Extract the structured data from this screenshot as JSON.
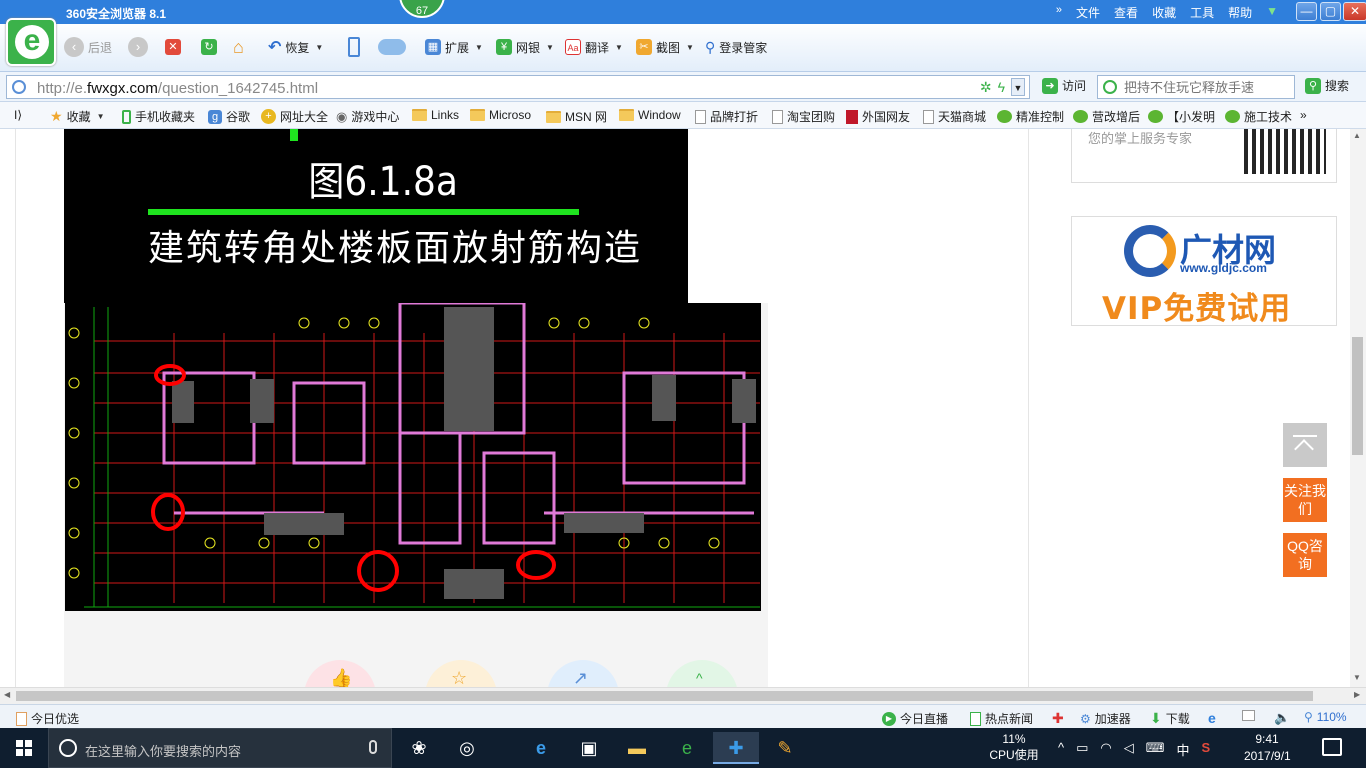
{
  "browser": {
    "title": "360安全浏览器 8.1",
    "badge_count": "67",
    "menu": [
      "文件",
      "查看",
      "收藏",
      "工具",
      "帮助"
    ],
    "chevron": "»",
    "window_buttons": [
      "—",
      "▢",
      "✕"
    ]
  },
  "toolbar": {
    "back": "后退",
    "restore": "恢复",
    "extend": "扩展",
    "netbank": "网银",
    "translate": "翻译",
    "screenshot": "截图",
    "login_manager": "登录管家"
  },
  "address": {
    "url_prefix": "http://e.",
    "url_domain": "fwxgx.com",
    "url_path": "/question_1642745.html",
    "visit": "访问",
    "search_placeholder": "把持不住玩它释放手速",
    "search_btn": "搜索"
  },
  "bookmarks": [
    {
      "label": "收藏",
      "icon": "star-icon"
    },
    {
      "label": "手机收藏夹",
      "icon": "phone-icon"
    },
    {
      "label": "谷歌",
      "icon": "google-icon"
    },
    {
      "label": "网址大全",
      "icon": "nav-icon"
    },
    {
      "label": "游戏中心",
      "icon": "gamepad-icon"
    },
    {
      "label": "Links",
      "icon": "folder-icon"
    },
    {
      "label": "Microso",
      "icon": "folder-icon"
    },
    {
      "label": "MSN 网",
      "icon": "folder-icon"
    },
    {
      "label": "Window",
      "icon": "folder-icon"
    },
    {
      "label": "品牌打折",
      "icon": "page-icon"
    },
    {
      "label": "淘宝团购",
      "icon": "page-icon"
    },
    {
      "label": "外国网友",
      "icon": "flag-icon"
    },
    {
      "label": "天猫商城",
      "icon": "page-icon"
    },
    {
      "label": "精准控制",
      "icon": "wechat-icon"
    },
    {
      "label": "营改增后",
      "icon": "wechat-icon"
    },
    {
      "label": "【小发明",
      "icon": "wechat-icon"
    },
    {
      "label": "施工技术",
      "icon": "wechat-icon"
    }
  ],
  "figure": {
    "title": "图6.1.8a",
    "subtitle": "建筑转角处楼板面放射筋构造"
  },
  "sidebar": {
    "qr_text": "您的掌上服务专家",
    "ad_brand": "广材网",
    "ad_site": "www.gldjc.com",
    "ad_slogan": "VIP免费试用",
    "follow_label": "关注我们",
    "qq_label": "QQ咨询"
  },
  "statusbar": {
    "today_pick": "今日优选",
    "live": "今日直播",
    "hot_news": "热点新闻",
    "accelerator": "加速器",
    "download": "下载",
    "zoom": "110%"
  },
  "taskbar": {
    "search_placeholder": "在这里输入你要搜索的内容",
    "cpu_percent": "11%",
    "cpu_label": "CPU使用",
    "ime": "中",
    "time": "9:41",
    "date": "2017/9/1"
  },
  "colors": {
    "titlebar": "#2f7fdc",
    "accent_orange": "#f26f21",
    "cad_background": "#000000",
    "annotation_red": "#ff0000",
    "taskbar": "#0f1e2f"
  }
}
